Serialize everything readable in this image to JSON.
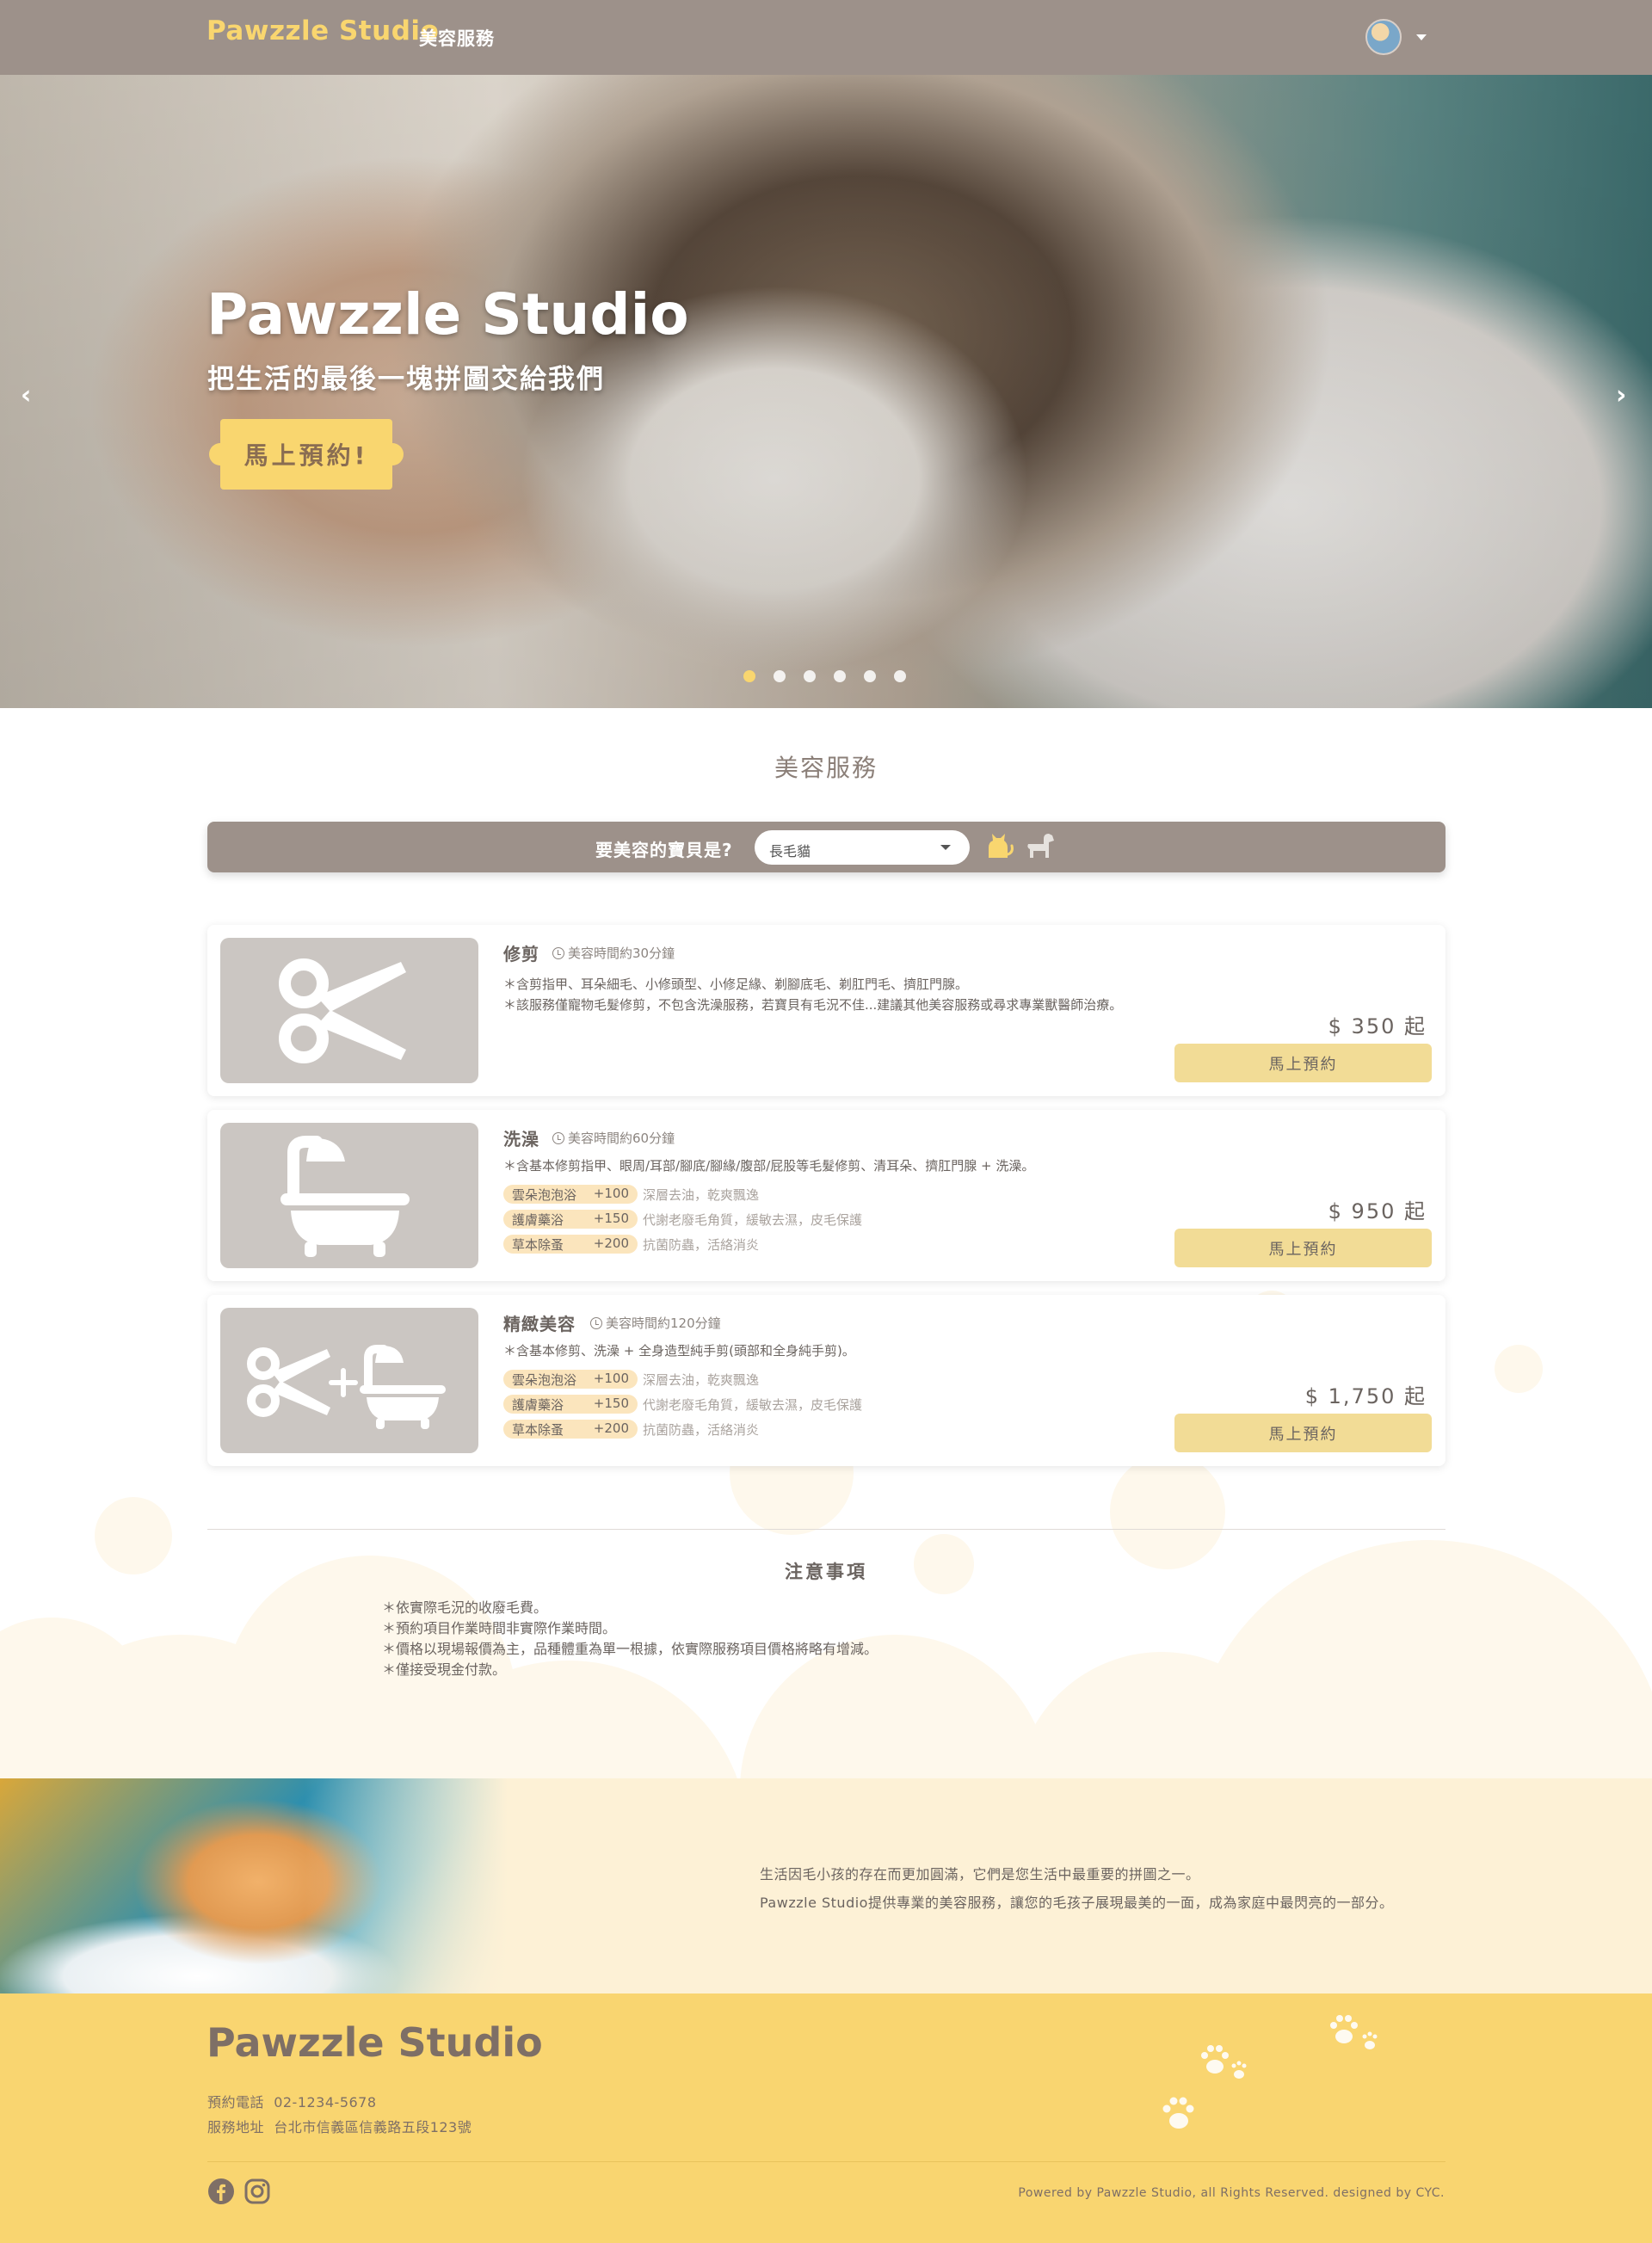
{
  "navbar": {
    "brand": "Pawzzle Studio",
    "link": "美容服務"
  },
  "hero": {
    "title": "Pawzzle Studio",
    "subtitle": "把生活的最後一塊拼圖交給我們",
    "cta": "馬上預約!",
    "prev": "‹",
    "next": "›",
    "slides": 6,
    "active_slide": 1
  },
  "services": {
    "title": "美容服務",
    "filter_label": "要美容的寶貝是?",
    "filter_value": "長毛貓",
    "cards": [
      {
        "title": "修剪",
        "time": "美容時間約30分鐘",
        "desc": [
          "＊含剪指甲、耳朵細毛、小修頭型、小修足緣、剃腳底毛、剃肛門毛、擠肛門腺。",
          "＊該服務僅寵物毛髮修剪，不包含洗澡服務，若寶貝有毛況不佳...建議其他美容服務或尋求專業獸醫師治療。"
        ],
        "addons": [],
        "price": "$ 350 起",
        "button": "馬上預約",
        "icon": "scissors-icon"
      },
      {
        "title": "洗澡",
        "time": "美容時間約60分鐘",
        "desc": [
          "＊含基本修剪指甲、眼周/耳部/腳底/腳緣/腹部/屁股等毛髮修剪、清耳朵、擠肛門腺 + 洗澡。"
        ],
        "addons": [
          {
            "name": "雲朵泡泡浴",
            "price": "+100",
            "note": "深層去油，乾爽飄逸"
          },
          {
            "name": "護膚藥浴",
            "price": "+150",
            "note": "代謝老廢毛角質，緩敏去濕，皮毛保護"
          },
          {
            "name": "草本除蚤",
            "price": "+200",
            "note": "抗菌防蟲，活絡消炎"
          }
        ],
        "price": "$ 950 起",
        "button": "馬上預約",
        "icon": "bathtub-icon"
      },
      {
        "title": "精緻美容",
        "time": "美容時間約120分鐘",
        "desc": [
          "＊含基本修剪、洗澡 + 全身造型純手剪(頭部和全身純手剪)。"
        ],
        "addons": [
          {
            "name": "雲朵泡泡浴",
            "price": "+100",
            "note": "深層去油，乾爽飄逸"
          },
          {
            "name": "護膚藥浴",
            "price": "+150",
            "note": "代謝老廢毛角質，緩敏去濕，皮毛保護"
          },
          {
            "name": "草本除蚤",
            "price": "+200",
            "note": "抗菌防蟲，活絡消炎"
          }
        ],
        "price": "$ 1,750 起",
        "button": "馬上預約",
        "icon": "scissors-plus-bathtub-icon"
      }
    ]
  },
  "notes": {
    "title": "注意事項",
    "items": [
      "＊依實際毛況的收廢毛費。",
      "＊預約項目作業時間非實際作業時間。",
      "＊價格以現場報價為主，品種體重為單一根據，依實際服務項目價格將略有增減。",
      "＊僅接受現金付款。"
    ]
  },
  "about": {
    "line1": "生活因毛小孩的存在而更加圓滿，它們是您生活中最重要的拼圖之一。",
    "line2": "Pawzzle Studio提供專業的美容服務，讓您的毛孩子展現最美的一面，成為家庭中最閃亮的一部分。"
  },
  "footer": {
    "brand": "Pawzzle Studio",
    "phone_label": "預約電話",
    "phone": "02-1234-5678",
    "address_label": "服務地址",
    "address": "台北市信義區信義路五段123號",
    "copyright": "Powered by Pawzzle Studio, all Rights Reserved. designed by CYC."
  },
  "colors": {
    "nav": "#9d918a",
    "accent": "#f9d66f",
    "button": "#f2dc96",
    "footer": "#f9d570"
  }
}
